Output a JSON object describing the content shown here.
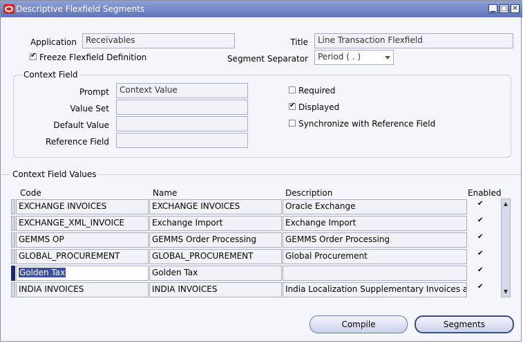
{
  "window": {
    "title": "Descriptive Flexfield Segments",
    "minimize_glyph": "▁",
    "maximize_glyph": "□",
    "close_glyph": "✕"
  },
  "header": {
    "application_label": "Application",
    "application_value": "Receivables",
    "title_label": "Title",
    "title_value": "Line Transaction Flexfield",
    "freeze_label": "Freeze Flexfield Definition",
    "freeze_checked": true,
    "separator_label": "Segment Separator",
    "separator_value": "Period ( . )"
  },
  "context_field": {
    "group_title": "Context Field",
    "prompt_label": "Prompt",
    "prompt_value": "Context Value",
    "value_set_label": "Value Set",
    "value_set_value": "",
    "default_value_label": "Default Value",
    "default_value_value": "",
    "reference_field_label": "Reference Field",
    "reference_field_value": "",
    "required_label": "Required",
    "required_checked": false,
    "displayed_label": "Displayed",
    "displayed_checked": true,
    "sync_label": "Synchronize with Reference Field",
    "sync_checked": false
  },
  "context_values": {
    "section_title": "Context Field Values",
    "columns": {
      "code": "Code",
      "name": "Name",
      "description": "Description",
      "enabled": "Enabled"
    },
    "rows": [
      {
        "code": "EXCHANGE INVOICES",
        "name": "EXCHANGE INVOICES",
        "description": "Oracle Exchange",
        "enabled": true,
        "selected": false
      },
      {
        "code": "EXCHANGE_XML_INVOICE",
        "name": "Exchange Import",
        "description": "Exchange Import",
        "enabled": true,
        "selected": false
      },
      {
        "code": "GEMMS OP",
        "name": "GEMMS Order Processing",
        "description": "GEMMS Order Processing",
        "enabled": true,
        "selected": false
      },
      {
        "code": "GLOBAL_PROCUREMENT",
        "name": "GLOBAL_PROCUREMENT",
        "description": "Global Procurement",
        "enabled": true,
        "selected": false
      },
      {
        "code": "Golden Tax",
        "name": "Golden Tax",
        "description": "",
        "enabled": true,
        "selected": true
      },
      {
        "code": "INDIA INVOICES",
        "name": "INDIA INVOICES",
        "description": "India Localization Supplementary Invoices and",
        "enabled": true,
        "selected": false
      }
    ]
  },
  "buttons": {
    "compile_label": "Compile",
    "segments_label": "Segments"
  },
  "colors": {
    "titlebar": "#6f82c2",
    "selection": "#3d4f99",
    "panel": "#f4f6fb"
  }
}
